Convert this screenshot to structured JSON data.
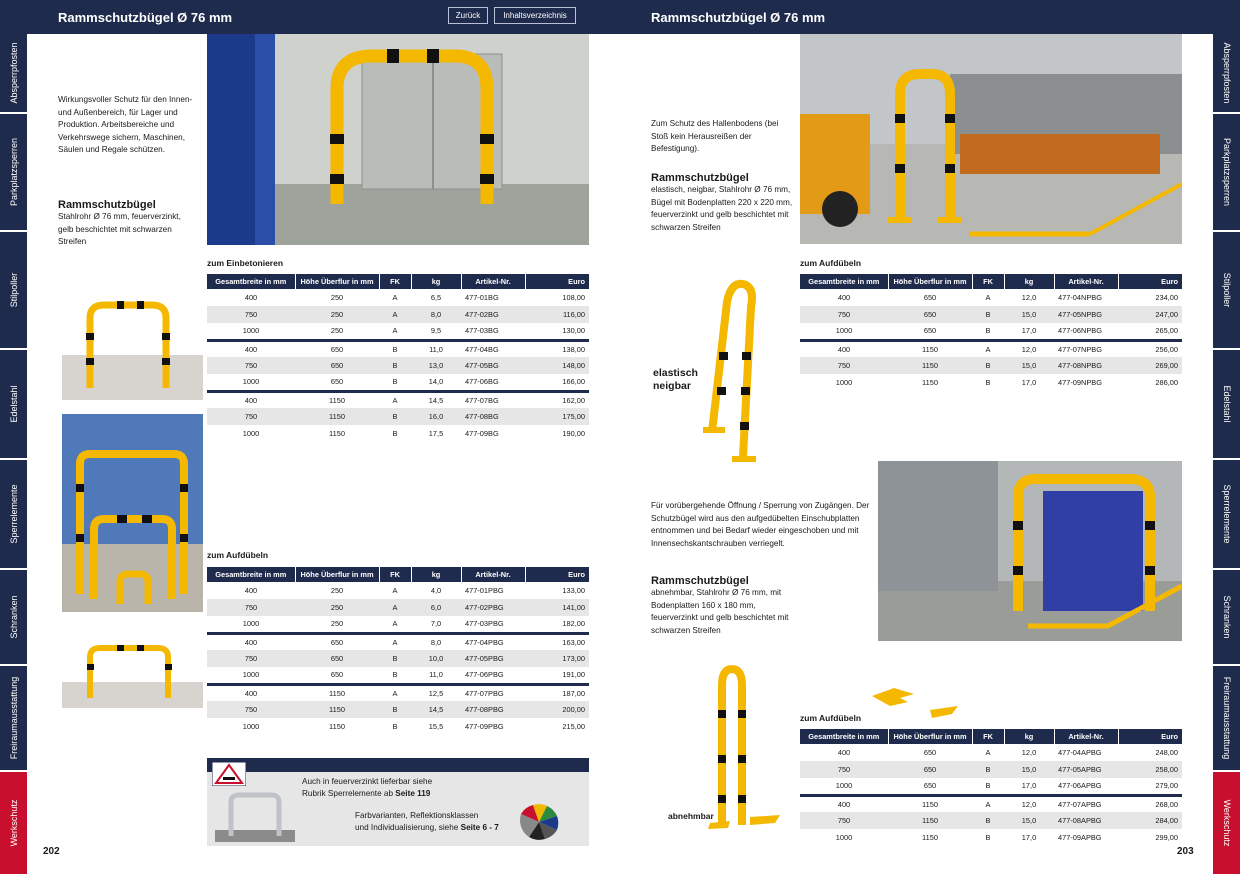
{
  "left_page": {
    "title": "Rammschutzbügel Ø 76 mm",
    "nav": {
      "back": "Zurück",
      "toc": "Inhaltsverzeichnis"
    },
    "intro": "Wirkungsvoller Schutz für den Innen- und Außenbereich, für Lager und Produktion. Arbeitsbereiche und Verkehrswege sichern, Maschinen, Säulen und Regale schützen.",
    "product_title": "Rammschutzbügel",
    "product_desc": "Stahlrohr Ø 76 mm, feuerverzinkt, gelb beschichtet mit schwarzen Streifen",
    "table1_caption": "zum Einbetonieren",
    "table2_caption": "zum Aufdübeln",
    "page_number": "202",
    "info_line1": "Auch in feuerverzinkt lieferbar siehe",
    "info_line2_prefix": "Rubrik Sperrelemente ab ",
    "info_line2_bold": "Seite 119",
    "info_line3": "Farbvarianten, Reflektionsklassen",
    "info_line4_prefix": "und Individualisierung, siehe ",
    "info_line4_bold": "Seite 6 - 7"
  },
  "right_page": {
    "title": "Rammschutzbügel Ø 76 mm",
    "intro": "Zum Schutz des Hallenbodens (bei Stoß kein Herausreißen der Befestigung).",
    "product1_title": "Rammschutzbügel",
    "product1_desc": "elastisch, neigbar, Stahlrohr Ø 76 mm, Bügel mit Bodenplatten 220 x 220 mm, feuerverzinkt und gelb beschichtet mit schwarzen Streifen",
    "label_elastic_1": "elastisch",
    "label_elastic_2": "neigbar",
    "table3_caption": "zum Aufdübeln",
    "intro2": "Für vorübergehende Öffnung / Sperrung von Zugängen. Der Schutzbügel wird aus den aufgedübelten Einschubplatten entnommen und bei Bedarf wieder eingeschoben und mit Innensechskantschrauben verriegelt.",
    "product2_title": "Rammschutzbügel",
    "product2_desc": "abnehmbar, Stahlrohr Ø 76 mm, mit Bodenplatten 160 x 180 mm, feuerverzinkt und gelb beschichtet mit schwarzen Streifen",
    "label_removable": "abnehmbar",
    "table4_caption": "zum Aufdübeln",
    "page_number": "203"
  },
  "side_tabs": [
    "Absperrpfosten",
    "Parkplatzsperren",
    "Stilpoller",
    "Edelstahl",
    "Sperrelemente",
    "Schranken",
    "Freiraumausstattung",
    "Werkschutz"
  ],
  "table_headers": [
    "Gesamtbreite in mm",
    "Höhe Überflur in mm",
    "FK",
    "kg",
    "Artikel-Nr.",
    "Euro"
  ],
  "tables": {
    "einbetonieren": [
      [
        "400",
        "250",
        "A",
        "6,5",
        "477-01BG",
        "108,00"
      ],
      [
        "750",
        "250",
        "A",
        "8,0",
        "477-02BG",
        "116,00"
      ],
      [
        "1000",
        "250",
        "A",
        "9,5",
        "477-03BG",
        "130,00"
      ],
      [
        "400",
        "650",
        "B",
        "11,0",
        "477-04BG",
        "138,00"
      ],
      [
        "750",
        "650",
        "B",
        "13,0",
        "477-05BG",
        "148,00"
      ],
      [
        "1000",
        "650",
        "B",
        "14,0",
        "477-06BG",
        "166,00"
      ],
      [
        "400",
        "1150",
        "A",
        "14,5",
        "477-07BG",
        "162,00"
      ],
      [
        "750",
        "1150",
        "B",
        "16,0",
        "477-08BG",
        "175,00"
      ],
      [
        "1000",
        "1150",
        "B",
        "17,5",
        "477-09BG",
        "190,00"
      ]
    ],
    "aufduebeln_left": [
      [
        "400",
        "250",
        "A",
        "4,0",
        "477-01PBG",
        "133,00"
      ],
      [
        "750",
        "250",
        "A",
        "6,0",
        "477-02PBG",
        "141,00"
      ],
      [
        "1000",
        "250",
        "A",
        "7,0",
        "477-03PBG",
        "182,00"
      ],
      [
        "400",
        "650",
        "A",
        "8,0",
        "477-04PBG",
        "163,00"
      ],
      [
        "750",
        "650",
        "B",
        "10,0",
        "477-05PBG",
        "173,00"
      ],
      [
        "1000",
        "650",
        "B",
        "11,0",
        "477-06PBG",
        "191,00"
      ],
      [
        "400",
        "1150",
        "A",
        "12,5",
        "477-07PBG",
        "187,00"
      ],
      [
        "750",
        "1150",
        "B",
        "14,5",
        "477-08PBG",
        "200,00"
      ],
      [
        "1000",
        "1150",
        "B",
        "15,5",
        "477-09PBG",
        "215,00"
      ]
    ],
    "aufduebeln_np": [
      [
        "400",
        "650",
        "A",
        "12,0",
        "477-04NPBG",
        "234,00"
      ],
      [
        "750",
        "650",
        "B",
        "15,0",
        "477-05NPBG",
        "247,00"
      ],
      [
        "1000",
        "650",
        "B",
        "17,0",
        "477-06NPBG",
        "265,00"
      ],
      [
        "400",
        "1150",
        "A",
        "12,0",
        "477-07NPBG",
        "256,00"
      ],
      [
        "750",
        "1150",
        "B",
        "15,0",
        "477-08NPBG",
        "269,00"
      ],
      [
        "1000",
        "1150",
        "B",
        "17,0",
        "477-09NPBG",
        "286,00"
      ]
    ],
    "aufduebeln_ap": [
      [
        "400",
        "650",
        "A",
        "12,0",
        "477-04APBG",
        "248,00"
      ],
      [
        "750",
        "650",
        "B",
        "15,0",
        "477-05APBG",
        "258,00"
      ],
      [
        "1000",
        "650",
        "B",
        "17,0",
        "477-06APBG",
        "279,00"
      ],
      [
        "400",
        "1150",
        "A",
        "12,0",
        "477-07APBG",
        "268,00"
      ],
      [
        "750",
        "1150",
        "B",
        "15,0",
        "477-08APBG",
        "284,00"
      ],
      [
        "1000",
        "1150",
        "B",
        "17,0",
        "477-09APBG",
        "299,00"
      ]
    ]
  },
  "colors": {
    "navy": "#1f2b4d",
    "red": "#c8102e",
    "yellow": "#f5b800",
    "grey_row": "#e6e6e6"
  }
}
